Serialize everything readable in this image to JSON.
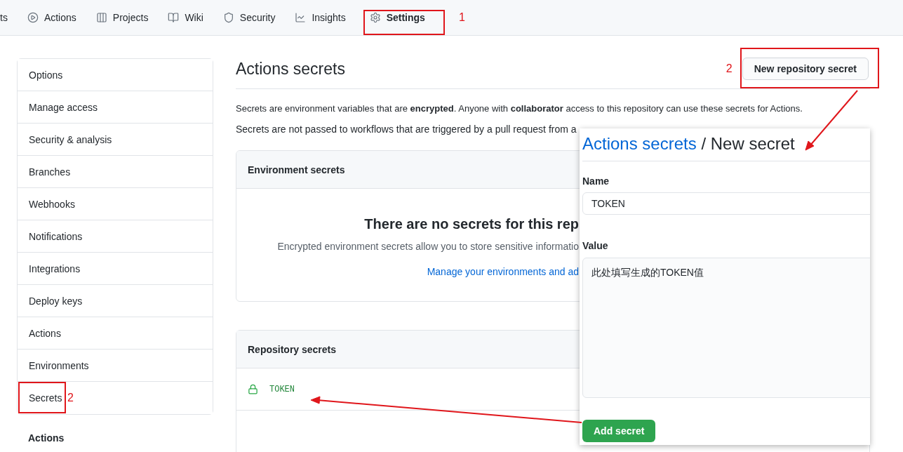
{
  "nav": {
    "tabs": [
      {
        "label": "ts",
        "selected": false
      },
      {
        "label": "Actions",
        "selected": false
      },
      {
        "label": "Projects",
        "selected": false
      },
      {
        "label": "Wiki",
        "selected": false
      },
      {
        "label": "Security",
        "selected": false
      },
      {
        "label": "Insights",
        "selected": false
      },
      {
        "label": "Settings",
        "selected": true
      }
    ],
    "callout": "1"
  },
  "sidebar": {
    "items": [
      {
        "label": "Options"
      },
      {
        "label": "Manage access"
      },
      {
        "label": "Security & analysis"
      },
      {
        "label": "Branches"
      },
      {
        "label": "Webhooks"
      },
      {
        "label": "Notifications"
      },
      {
        "label": "Integrations"
      },
      {
        "label": "Deploy keys"
      },
      {
        "label": "Actions"
      },
      {
        "label": "Environments"
      },
      {
        "label": "Secrets"
      }
    ],
    "callout": "2",
    "section_heading": "Actions"
  },
  "main": {
    "title": "Actions secrets",
    "new_button": "New repository secret",
    "callout": "2",
    "description": "Secrets are environment variables that are **encrypted**. Anyone with **collaborator** access to this repository can use these secrets for Actions.",
    "note": "Secrets are not passed to workflows that are triggered by a pull request from a",
    "environment_secrets": {
      "heading": "Environment secrets",
      "empty_title": "There are no secrets for this rep",
      "empty_text": "Encrypted environment secrets allow you to store sensitive informatio",
      "link": "Manage your environments and ad"
    },
    "repository_secrets": {
      "heading": "Repository secrets",
      "rows": [
        {
          "name": "TOKEN"
        }
      ]
    }
  },
  "new_secret_panel": {
    "breadcrumb_link": "Actions secrets",
    "breadcrumb_current": "/ New secret",
    "name_label": "Name",
    "name_value": "TOKEN",
    "value_label": "Value",
    "value_value": "此处填写生成的TOKEN值",
    "submit": "Add secret"
  }
}
